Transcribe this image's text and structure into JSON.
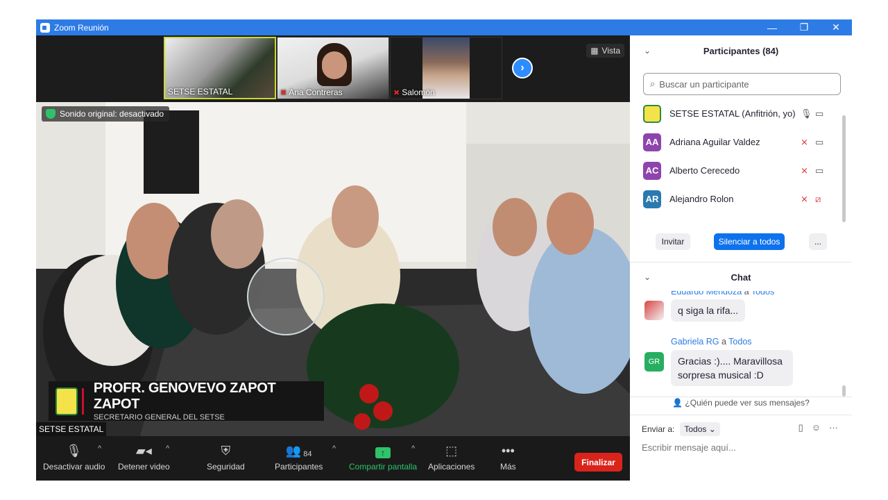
{
  "window": {
    "title": "Zoom Reunión",
    "minimize": "—",
    "restore": "❐",
    "close": "✕"
  },
  "thumbnails": [
    {
      "name": "SETSE ESTATAL",
      "muted": false
    },
    {
      "name": "Ana Contreras",
      "muted": true
    },
    {
      "name": "Salomón",
      "muted": true
    }
  ],
  "next_button": "›",
  "view_button": "Vista",
  "video": {
    "sound_badge": "Sonido original: desactivado",
    "lower_third_name": "PROFR. GENOVEVO ZAPOT ZAPOT",
    "lower_third_title": "SECRETARIO GENERAL DEL SETSE",
    "speaker_label": "SETSE ESTATAL"
  },
  "toolbar": {
    "audio": "Desactivar audio",
    "video": "Detener video",
    "security": "Seguridad",
    "participants": "Participantes",
    "participants_count": "84",
    "share": "Compartir pantalla",
    "apps": "Aplicaciones",
    "more": "Más",
    "end": "Finalizar"
  },
  "participants_panel": {
    "title": "Participantes (84)",
    "search_placeholder": "Buscar un participante",
    "rows": [
      {
        "initials": "",
        "name": "SETSE ESTATAL (Anfitrión, yo)",
        "color": "#f3e24a"
      },
      {
        "initials": "AA",
        "name": "Adriana Aguilar Valdez",
        "color": "#8e44ad"
      },
      {
        "initials": "AC",
        "name": "Alberto Cerecedo",
        "color": "#8e44ad"
      },
      {
        "initials": "AR",
        "name": "Alejandro Rolon",
        "color": "#2a7ab0"
      }
    ],
    "invite": "Invitar",
    "mute_all": "Silenciar a todos",
    "more": "..."
  },
  "chat_panel": {
    "title": "Chat",
    "messages": [
      {
        "from": "Eduardo Mendoza",
        "to_word": "a",
        "to": "Todos",
        "text": "q siga la rifa..."
      },
      {
        "from": "Gabriela RG",
        "to_word": "a",
        "to": "Todos",
        "initials": "GR",
        "text": "Gracias :).... Maravillosa sorpresa musical :D"
      }
    ],
    "who_can_see": "¿Quién puede ver sus mensajes?",
    "send_to_label": "Enviar a:",
    "send_to_value": "Todos",
    "compose_placeholder": "Escribir mensaje aquí..."
  },
  "colors": {
    "accent": "#2d8cff",
    "end": "#d9241c",
    "share": "#2ec26a"
  }
}
